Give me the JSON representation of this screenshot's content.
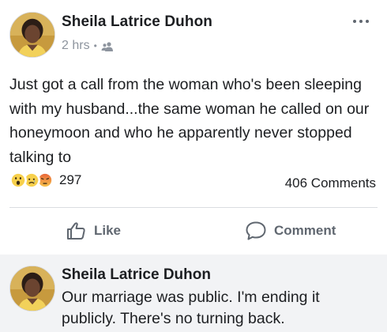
{
  "post": {
    "author_name": "Sheila Latrice Duhon",
    "timestamp": "2 hrs",
    "separator": "•",
    "audience_icon": "friends-icon",
    "text": "Just got a call from the woman who's been sleeping with my husband...the same woman he called on our honeymoon and who he apparently never stopped talking to",
    "reactions": {
      "types": [
        "wow",
        "sad",
        "angry"
      ],
      "count": "297"
    },
    "comments_count": "406 Comments",
    "actions": {
      "like_label": "Like",
      "comment_label": "Comment"
    }
  },
  "comment": {
    "author_name": "Sheila Latrice Duhon",
    "text": "Our marriage was public. I'm ending it publicly. There's no turning back."
  },
  "colors": {
    "text_primary": "#1c1e21",
    "text_secondary": "#8d949e",
    "action_gray": "#606770",
    "comment_bg": "#f2f3f5",
    "reaction_yellow": "#f7d04c",
    "reaction_angry": "#e9663a"
  }
}
